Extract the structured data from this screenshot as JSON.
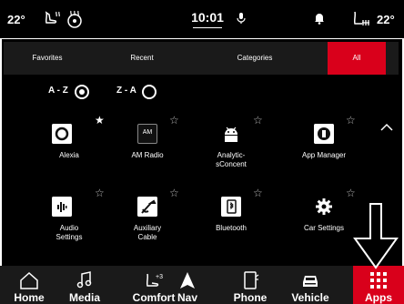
{
  "status": {
    "temp_left": "22°",
    "time": "10:01",
    "temp_right": "22°"
  },
  "tabs": [
    {
      "label": "Favorites"
    },
    {
      "label": "Recent"
    },
    {
      "label": "Categories"
    },
    {
      "label": "All"
    }
  ],
  "sort": {
    "az_label": "A - Z",
    "za_label": "Z - A",
    "selected": "A - Z"
  },
  "apps": [
    {
      "label": "Alexia",
      "icon": "alexa-ring-icon",
      "favorite": true
    },
    {
      "label": "AM Radio",
      "icon": "am-radio-icon",
      "icon_text": "AM",
      "favorite": false
    },
    {
      "label": "Analytic-\nsConcent",
      "icon": "android-icon",
      "favorite": false
    },
    {
      "label": "App Manager",
      "icon": "app-manager-icon",
      "favorite": false
    },
    {
      "label": "Audio\nSettings",
      "icon": "audio-settings-icon",
      "favorite": false
    },
    {
      "label": "Auxiliary\nCable",
      "icon": "aux-cable-icon",
      "favorite": false
    },
    {
      "label": "Bluetooth",
      "icon": "bluetooth-phone-icon",
      "favorite": false
    },
    {
      "label": "Car Settings",
      "icon": "gear-icon",
      "favorite": false
    }
  ],
  "nav": [
    {
      "label": "Home",
      "icon": "home-icon"
    },
    {
      "label": "Media",
      "icon": "music-note-icon"
    },
    {
      "label": "Comfort",
      "icon": "seat-heat-icon"
    },
    {
      "label": "Nav",
      "icon": "navigation-arrow-icon"
    },
    {
      "label": "Phone",
      "icon": "phone-icon"
    },
    {
      "label": "Vehicle",
      "icon": "car-icon"
    },
    {
      "label": "Apps",
      "icon": "grid-icon"
    }
  ],
  "active_nav": "Apps",
  "colors": {
    "accent": "#d9001b",
    "bar": "#1a1a1a",
    "background": "#000000"
  }
}
